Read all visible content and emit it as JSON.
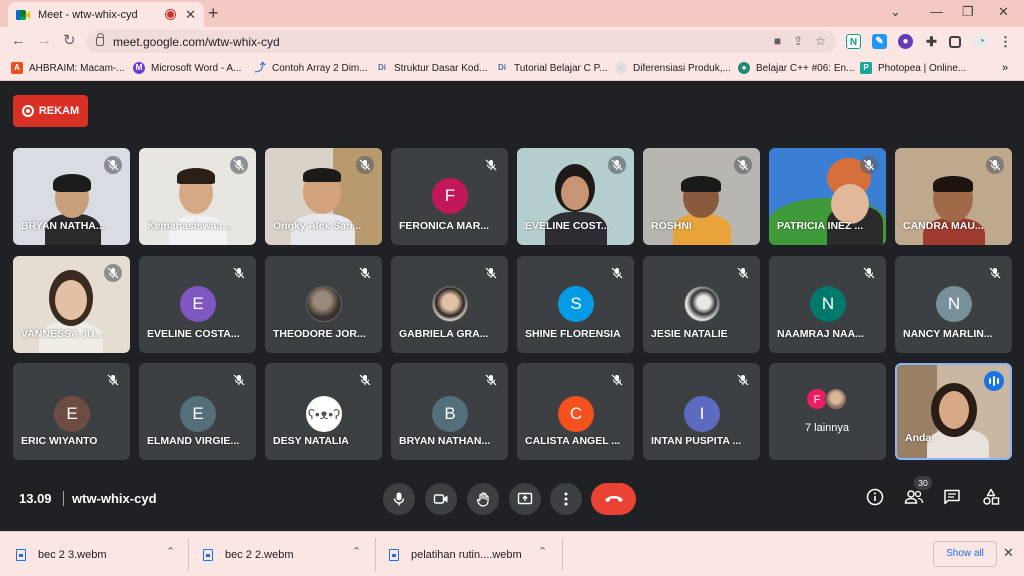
{
  "browser": {
    "tab_title": "Meet - wtw-whix-cyd",
    "new_tab": "+",
    "url": "meet.google.com/wtw-whix-cyd",
    "bookmarks": [
      {
        "label": "AHBRAIM: Macam-...",
        "color": "#e8501c",
        "glyph": "A"
      },
      {
        "label": "Microsoft Word - A...",
        "color": "#6a3fd6",
        "glyph": "M"
      },
      {
        "label": "Contoh Array 2 Dim...",
        "color": "#3a7bd5",
        "glyph": "C"
      },
      {
        "label": "Struktur Dasar Kod...",
        "color": "#4f6fb0",
        "glyph": "Di"
      },
      {
        "label": "Tutorial Belajar C P...",
        "color": "#4f6fb0",
        "glyph": "Di"
      },
      {
        "label": "Diferensiasi Produk,...",
        "color": "#9aa0a6",
        "glyph": "D"
      },
      {
        "label": "Belajar C++ #06: En...",
        "color": "#1f8a70",
        "glyph": "B"
      },
      {
        "label": "Photopea | Online...",
        "color": "#18a497",
        "glyph": "P"
      }
    ],
    "bookmarks_more": "»"
  },
  "meet": {
    "record_label": "REKAM",
    "time": "13.09",
    "code": "wtw-whix-cyd",
    "participant_count": "30",
    "others_label": "7 lainnya",
    "participants": [
      {
        "name": "BRYAN NATHA...",
        "kind": "video"
      },
      {
        "name": "Kemahasiswaa...",
        "kind": "video"
      },
      {
        "name": "Ongky Alex San...",
        "kind": "video"
      },
      {
        "name": "FERONICA MAR...",
        "kind": "avatar",
        "initial": "F",
        "color": "#c2185b"
      },
      {
        "name": "EVELINE COST...",
        "kind": "video"
      },
      {
        "name": "ROSHNI",
        "kind": "video"
      },
      {
        "name": "PATRICIA INEZ ...",
        "kind": "video"
      },
      {
        "name": "CANDRA MAU...",
        "kind": "video"
      },
      {
        "name": "VANNESSA JU...",
        "kind": "video"
      },
      {
        "name": "EVELINE COSTA...",
        "kind": "avatar",
        "initial": "E",
        "color": "#7e57c2"
      },
      {
        "name": "THEODORE JOR...",
        "kind": "photo",
        "color": "#5d4e45"
      },
      {
        "name": "GABRIELA GRA...",
        "kind": "photo",
        "color": "#b89b7e"
      },
      {
        "name": "SHINE FLORENSIA",
        "kind": "avatar",
        "initial": "S",
        "color": "#039be5"
      },
      {
        "name": "JESIE NATALIE",
        "kind": "photo",
        "color": "#d0d0d0"
      },
      {
        "name": "NAAMRAJ NAA...",
        "kind": "avatar",
        "initial": "N",
        "color": "#00796b"
      },
      {
        "name": "NANCY MARLIN...",
        "kind": "avatar",
        "initial": "N",
        "color": "#78909c"
      },
      {
        "name": "ERIC WIYANTO",
        "kind": "avatar",
        "initial": "E",
        "color": "#6d4c41"
      },
      {
        "name": "ELMAND VIRGIE...",
        "kind": "avatar",
        "initial": "E",
        "color": "#546e7a"
      },
      {
        "name": "DESY NATALIA",
        "kind": "photo",
        "color": "#ffffff"
      },
      {
        "name": "BRYAN NATHAN...",
        "kind": "avatar",
        "initial": "B",
        "color": "#546e7a"
      },
      {
        "name": "CALISTA ANGEL ...",
        "kind": "avatar",
        "initial": "C",
        "color": "#f4511e"
      },
      {
        "name": "INTAN PUSPITA ...",
        "kind": "avatar",
        "initial": "I",
        "color": "#5c6bc0"
      }
    ],
    "others_avatars": [
      {
        "initial": "F",
        "color": "#e91e63"
      },
      {
        "initial": "",
        "color": "#8d6e63"
      }
    ],
    "self_label": "Anda"
  },
  "downloads": [
    {
      "label": "bec 2 3.webm"
    },
    {
      "label": "bec 2 2.webm"
    },
    {
      "label": "pelatihan rutin....webm"
    }
  ],
  "show_all_label": "Show all"
}
